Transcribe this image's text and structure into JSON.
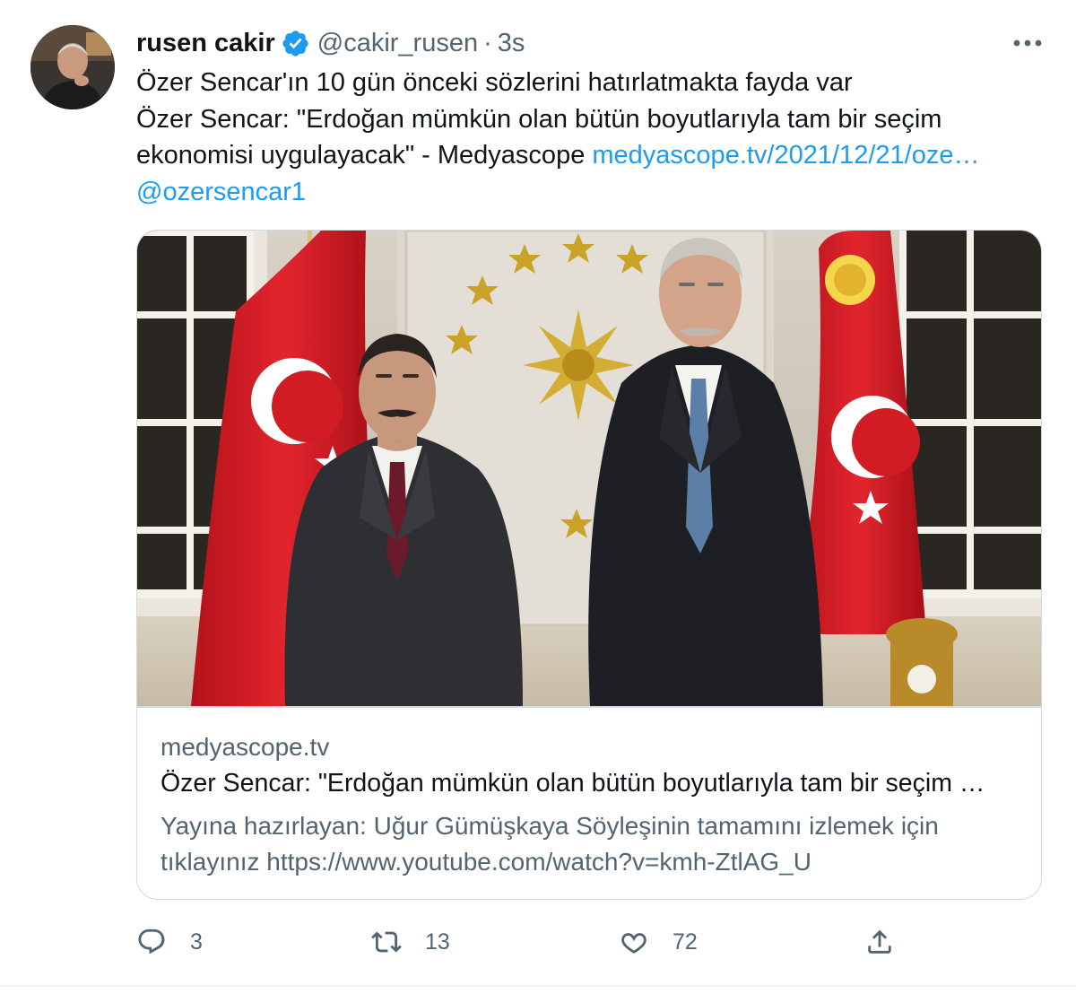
{
  "author": {
    "display_name": "rusen cakir",
    "handle": "@cakir_rusen",
    "separator": "·",
    "time": "3s",
    "verified": true
  },
  "tweet": {
    "line1": "Özer Sencar'ın 10 gün önceki sözlerini hatırlatmakta fayda var",
    "line2": "Özer Sencar: \"Erdoğan mümkün olan bütün boyutlarıyla tam bir seçim",
    "line3_text": "ekonomisi uygulayacak\" - Medyascope ",
    "line3_link": "medyascope.tv/2021/12/21/oze…",
    "mention": "@ozersencar1"
  },
  "card": {
    "domain": "medyascope.tv",
    "title": "Özer Sencar: \"Erdoğan mümkün olan bütün boyutlarıyla tam bir seçim …",
    "desc_line1": "Yayına hazırlayan: Uğur Gümüşkaya Söyleşinin tamamını izlemek için",
    "desc_line2": "tıklayınız https://www.youtube.com/watch?v=kmh-ZtlAG_U"
  },
  "actions": {
    "replies": "3",
    "retweets": "13",
    "likes": "72"
  },
  "icons": {
    "verified": "verified-badge-icon",
    "more": "more-dots-icon",
    "reply": "reply-icon",
    "retweet": "retweet-icon",
    "like": "heart-icon",
    "share": "share-icon"
  },
  "colors": {
    "accent": "#1d9bf0",
    "secondary_text": "#536471",
    "border": "#cfd9de"
  }
}
